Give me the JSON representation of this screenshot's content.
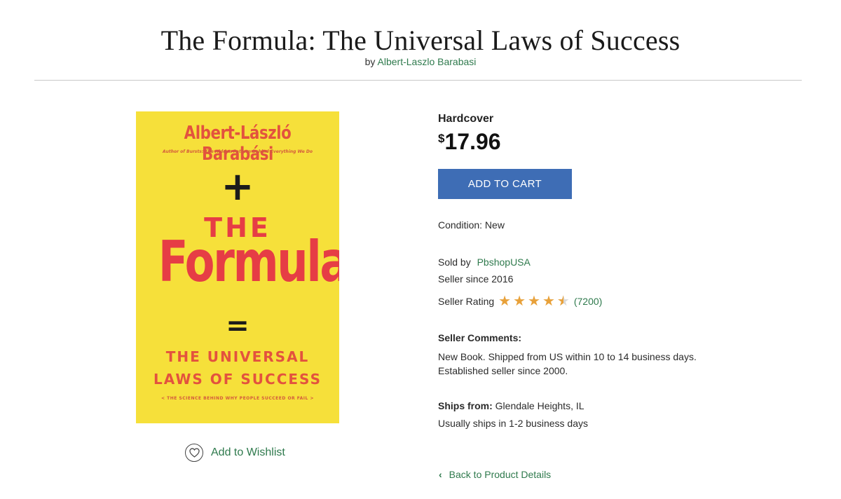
{
  "header": {
    "title": "The Formula: The Universal Laws of Success",
    "by_prefix": "by",
    "author": "Albert-Laszlo Barabasi"
  },
  "cover": {
    "author": "Albert-László Barabási",
    "tagline": "Author of Bursts: The Hidden Pattern Behind Everything We Do",
    "plus": "+",
    "title_top": "THE",
    "title_main": "Formula",
    "equals": "=",
    "subtitle_line1": "THE UNIVERSAL",
    "subtitle_line2": "LAWS OF SUCCESS",
    "subtitle_small": "< THE SCIENCE BEHIND WHY PEOPLE SUCCEED OR FAIL >"
  },
  "wishlist": {
    "label": "Add to Wishlist",
    "icon": "heart-icon"
  },
  "product": {
    "format": "Hardcover",
    "currency": "$",
    "price": "17.96",
    "add_to_cart": "ADD TO CART",
    "condition": "Condition: New",
    "sold_by_label": "Sold by",
    "seller": "PbshopUSA",
    "seller_since": "Seller since 2016",
    "rating_label": "Seller Rating",
    "rating_value": 4.5,
    "rating_max": 5,
    "rating_count": "(7200)",
    "comments_label": "Seller Comments:",
    "comments_text": "New Book. Shipped from US within 10 to 14 business days. Established seller since 2000.",
    "ships_from_label": "Ships from:",
    "ships_from_value": " Glendale Heights, IL",
    "ships_time": "Usually ships in 1-2 business days",
    "back_link": "Back to Product Details"
  },
  "colors": {
    "accent_green": "#2f7a4d",
    "button_blue": "#3e6db5",
    "star_orange": "#e8a13a",
    "cover_yellow": "#f6e03a",
    "cover_red": "#e63d45"
  }
}
